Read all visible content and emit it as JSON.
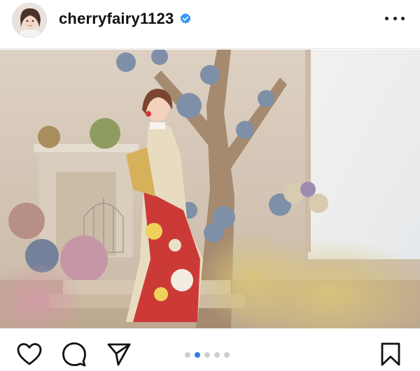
{
  "post": {
    "username": "cherryfairy1123",
    "verified": true,
    "avatar_icon": "user-avatar-photo",
    "more_icon": "more-options-icon",
    "image_alt_icon": "kimono-photo"
  },
  "actions": {
    "like_icon": "heart-icon",
    "comment_icon": "comment-bubble-icon",
    "share_icon": "paper-plane-icon",
    "save_icon": "bookmark-icon"
  },
  "carousel": {
    "total": 5,
    "active_index": 1
  },
  "colors": {
    "verified_blue": "#3897f0",
    "active_dot": "#2f7ee0",
    "inactive_dot": "#cfcfcf",
    "text": "#111111"
  }
}
